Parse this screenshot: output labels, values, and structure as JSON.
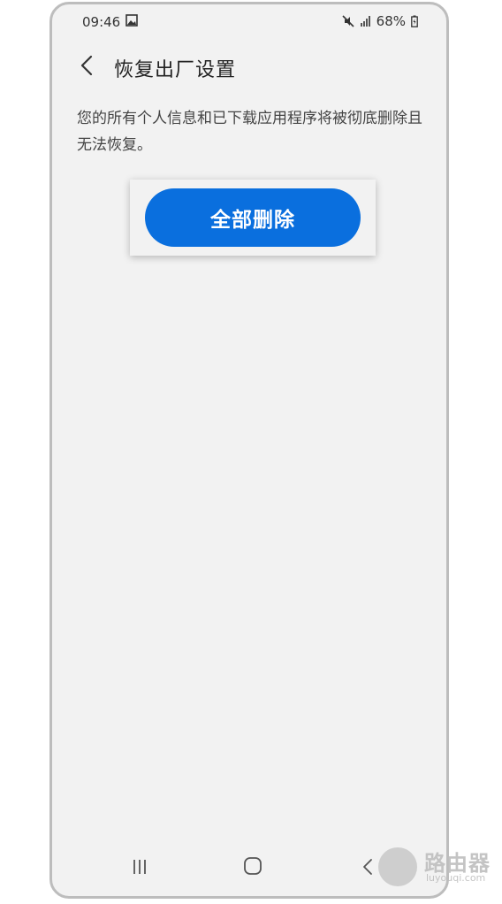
{
  "status_bar": {
    "time": "09:46",
    "battery": "68%",
    "icons": [
      "gallery-icon",
      "mute-icon",
      "signal-icon",
      "battery-charging-icon"
    ]
  },
  "header": {
    "title": "恢复出厂设置",
    "back_icon": "chevron-left-icon"
  },
  "main": {
    "description": "您的所有个人信息和已下载应用程序将被彻底删除且无法恢复。",
    "delete_button_label": "全部删除"
  },
  "nav_bar": {
    "icons": [
      "recent-apps-icon",
      "home-icon",
      "back-icon"
    ]
  },
  "watermark": {
    "title": "路由器",
    "subtitle": "luyouqi.com"
  },
  "colors": {
    "accent": "#0a6fde",
    "background": "#f2f2f2",
    "text": "#444444"
  }
}
